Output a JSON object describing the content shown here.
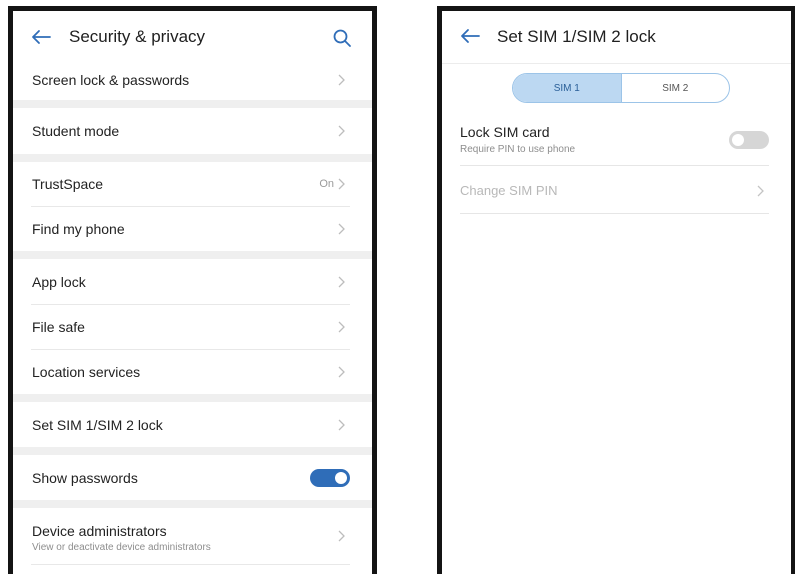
{
  "left": {
    "title": "Security & privacy",
    "groups": [
      {
        "items": [
          {
            "label": "Screen lock & passwords"
          }
        ]
      },
      {
        "items": [
          {
            "label": "Student mode"
          }
        ]
      },
      {
        "items": [
          {
            "label": "TrustSpace",
            "value": "On"
          },
          {
            "label": "Find my phone"
          }
        ]
      },
      {
        "items": [
          {
            "label": "App lock"
          },
          {
            "label": "File safe"
          },
          {
            "label": "Location services"
          }
        ]
      },
      {
        "items": [
          {
            "label": "Set SIM 1/SIM 2 lock"
          }
        ]
      },
      {
        "items": [
          {
            "label": "Show passwords",
            "toggle": true
          }
        ]
      },
      {
        "items": [
          {
            "label": "Device administrators",
            "sublabel": "View or deactivate device administrators"
          }
        ]
      }
    ]
  },
  "right": {
    "title": "Set SIM 1/SIM 2 lock",
    "tabs": [
      "SIM 1",
      "SIM 2"
    ],
    "active_tab": "SIM 1",
    "lock_sim": {
      "label": "Lock SIM card",
      "sublabel": "Require PIN to use phone",
      "enabled": false
    },
    "change_pin": {
      "label": "Change SIM PIN",
      "disabled": true
    }
  },
  "colors": {
    "accent": "#2f6db8",
    "segment_active": "#bcd8f2",
    "separator": "#efefef",
    "frame": "#141414"
  },
  "icons": {
    "back": "arrow-left-icon",
    "search": "search-icon",
    "chevron": "chevron-right-icon"
  }
}
